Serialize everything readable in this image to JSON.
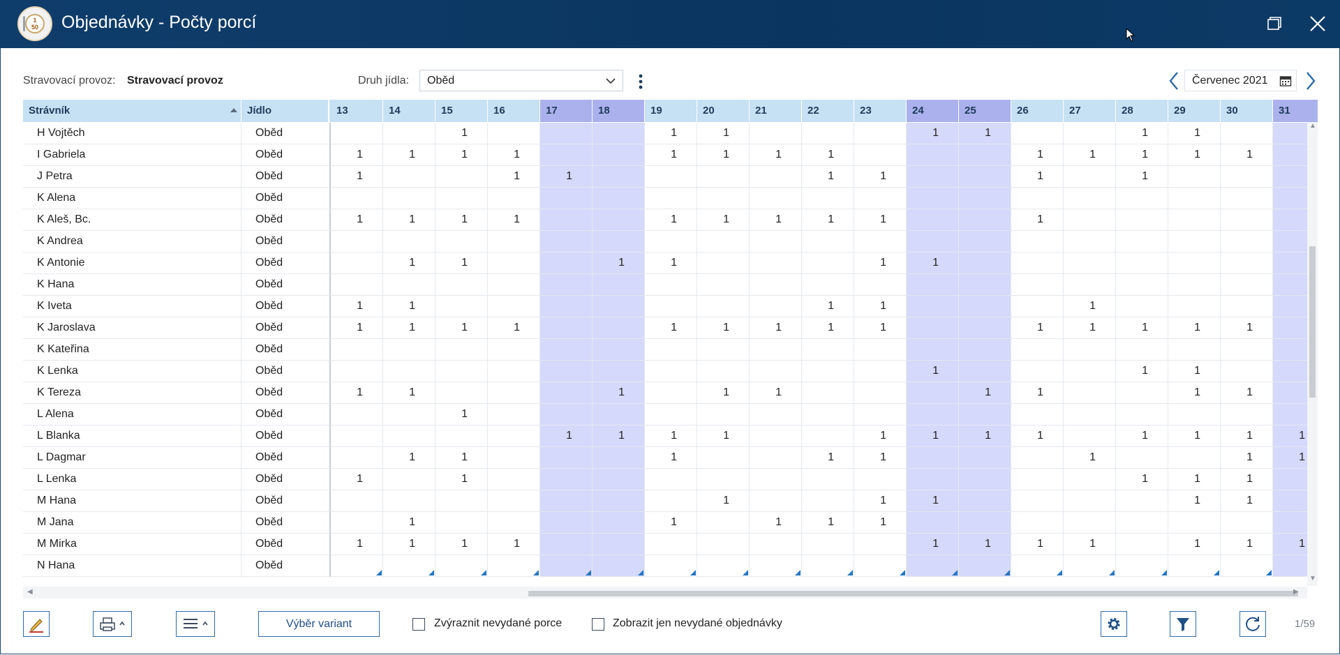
{
  "window": {
    "title": "Objednávky - Počty porcí",
    "logo_text_top": "1",
    "logo_text_bottom": "50"
  },
  "filters": {
    "provoz_label": "Stravovací provoz:",
    "provoz_value": "Stravovací provoz",
    "druh_label": "Druh jídla:",
    "druh_value": "Oběd",
    "month_value": "Červenec 2021"
  },
  "columns": {
    "name_header": "Strávník",
    "meal_header": "Jídlo",
    "days": [
      "13",
      "14",
      "15",
      "16",
      "17",
      "18",
      "19",
      "20",
      "21",
      "22",
      "23",
      "24",
      "25",
      "26",
      "27",
      "28",
      "29",
      "30",
      "31"
    ],
    "weekend_days": [
      "17",
      "18",
      "24",
      "25",
      "31"
    ]
  },
  "rows": [
    {
      "name": "H Vojtěch",
      "meal": "Oběd",
      "values": [
        "",
        "",
        "1",
        "",
        "",
        "",
        "1",
        "1",
        "",
        "",
        "",
        "1",
        "1",
        "",
        "",
        "1",
        "1",
        "",
        ""
      ]
    },
    {
      "name": "I Gabriela",
      "meal": "Oběd",
      "values": [
        "1",
        "1",
        "1",
        "1",
        "",
        "",
        "1",
        "1",
        "1",
        "1",
        "",
        "",
        "",
        "1",
        "1",
        "1",
        "1",
        "1",
        ""
      ]
    },
    {
      "name": "J Petra",
      "meal": "Oběd",
      "values": [
        "1",
        "",
        "",
        "1",
        "1",
        "",
        "",
        "",
        "",
        "1",
        "1",
        "",
        "",
        "1",
        "",
        "1",
        "",
        "",
        ""
      ]
    },
    {
      "name": "K Alena",
      "meal": "Oběd",
      "values": [
        "",
        "",
        "",
        "",
        "",
        "",
        "",
        "",
        "",
        "",
        "",
        "",
        "",
        "",
        "",
        "",
        "",
        "",
        ""
      ]
    },
    {
      "name": "K Aleš, Bc.",
      "meal": "Oběd",
      "values": [
        "1",
        "1",
        "1",
        "1",
        "",
        "",
        "1",
        "1",
        "1",
        "1",
        "1",
        "",
        "",
        "1",
        "",
        "",
        "",
        "",
        ""
      ]
    },
    {
      "name": "K Andrea",
      "meal": "Oběd",
      "values": [
        "",
        "",
        "",
        "",
        "",
        "",
        "",
        "",
        "",
        "",
        "",
        "",
        "",
        "",
        "",
        "",
        "",
        "",
        ""
      ]
    },
    {
      "name": "K Antonie",
      "meal": "Oběd",
      "values": [
        "",
        "1",
        "1",
        "",
        "",
        "1",
        "1",
        "",
        "",
        "",
        "1",
        "1",
        "",
        "",
        "",
        "",
        "",
        "",
        ""
      ]
    },
    {
      "name": "K Hana",
      "meal": "Oběd",
      "values": [
        "",
        "",
        "",
        "",
        "",
        "",
        "",
        "",
        "",
        "",
        "",
        "",
        "",
        "",
        "",
        "",
        "",
        "",
        ""
      ]
    },
    {
      "name": "K Iveta",
      "meal": "Oběd",
      "values": [
        "1",
        "1",
        "",
        "",
        "",
        "",
        "",
        "",
        "",
        "1",
        "1",
        "",
        "",
        "",
        "1",
        "",
        "",
        "",
        ""
      ]
    },
    {
      "name": "K Jaroslava",
      "meal": "Oběd",
      "values": [
        "1",
        "1",
        "1",
        "1",
        "",
        "",
        "1",
        "1",
        "1",
        "1",
        "1",
        "",
        "",
        "1",
        "1",
        "1",
        "1",
        "1",
        ""
      ]
    },
    {
      "name": "K Kateřina",
      "meal": "Oběd",
      "values": [
        "",
        "",
        "",
        "",
        "",
        "",
        "",
        "",
        "",
        "",
        "",
        "",
        "",
        "",
        "",
        "",
        "",
        "",
        ""
      ]
    },
    {
      "name": "K Lenka",
      "meal": "Oběd",
      "values": [
        "",
        "",
        "",
        "",
        "",
        "",
        "",
        "",
        "",
        "",
        "",
        "1",
        "",
        "",
        "",
        "1",
        "1",
        "",
        ""
      ]
    },
    {
      "name": "K Tereza",
      "meal": "Oběd",
      "values": [
        "1",
        "1",
        "",
        "",
        "",
        "1",
        "",
        "1",
        "1",
        "",
        "",
        "",
        "1",
        "1",
        "",
        "",
        "1",
        "1",
        ""
      ]
    },
    {
      "name": "L Alena",
      "meal": "Oběd",
      "values": [
        "",
        "",
        "1",
        "",
        "",
        "",
        "",
        "",
        "",
        "",
        "",
        "",
        "",
        "",
        "",
        "",
        "",
        "",
        ""
      ]
    },
    {
      "name": "L Blanka",
      "meal": "Oběd",
      "values": [
        "",
        "",
        "",
        "",
        "1",
        "1",
        "1",
        "1",
        "",
        "",
        "1",
        "1",
        "1",
        "1",
        "",
        "1",
        "1",
        "1",
        "1"
      ]
    },
    {
      "name": "L Dagmar",
      "meal": "Oběd",
      "values": [
        "",
        "1",
        "1",
        "",
        "",
        "",
        "1",
        "",
        "",
        "1",
        "1",
        "",
        "",
        "",
        "1",
        "",
        "",
        "1",
        "1"
      ]
    },
    {
      "name": "L Lenka",
      "meal": "Oběd",
      "values": [
        "1",
        "",
        "1",
        "",
        "",
        "",
        "",
        "",
        "",
        "",
        "",
        "",
        "",
        "",
        "",
        "1",
        "1",
        "1",
        ""
      ]
    },
    {
      "name": "M Hana",
      "meal": "Oběd",
      "values": [
        "",
        "",
        "",
        "",
        "",
        "",
        "",
        "1",
        "",
        "",
        "1",
        "1",
        "",
        "",
        "",
        "",
        "1",
        "1",
        ""
      ]
    },
    {
      "name": "M Jana",
      "meal": "Oběd",
      "values": [
        "",
        "1",
        "",
        "",
        "",
        "",
        "1",
        "",
        "1",
        "1",
        "1",
        "",
        "",
        "",
        "",
        "",
        "",
        "",
        ""
      ]
    },
    {
      "name": "M Mirka",
      "meal": "Oběd",
      "values": [
        "1",
        "1",
        "1",
        "1",
        "",
        "",
        "",
        "",
        "",
        "",
        "",
        "1",
        "1",
        "1",
        "1",
        "",
        "1",
        "1",
        "1"
      ]
    },
    {
      "name": "N Hana",
      "meal": "Oběd",
      "values": [
        "",
        "",
        "",
        "",
        "",
        "",
        "",
        "",
        "",
        "",
        "",
        "",
        "",
        "",
        "",
        "",
        "",
        "",
        ""
      ]
    }
  ],
  "toolbar": {
    "variant_button": "Výběr variant",
    "checkbox1_label": "Zvýraznit nevydané porce",
    "checkbox2_label": "Zobrazit jen nevydané objednávky",
    "page_count": "1/59"
  },
  "colors": {
    "titlebar": "#0f3d6b",
    "header": "#c7e1f4",
    "weekend_header": "#aab1ec",
    "weekend_cell": "#d5d9fb",
    "accent": "#2f6aa8"
  }
}
